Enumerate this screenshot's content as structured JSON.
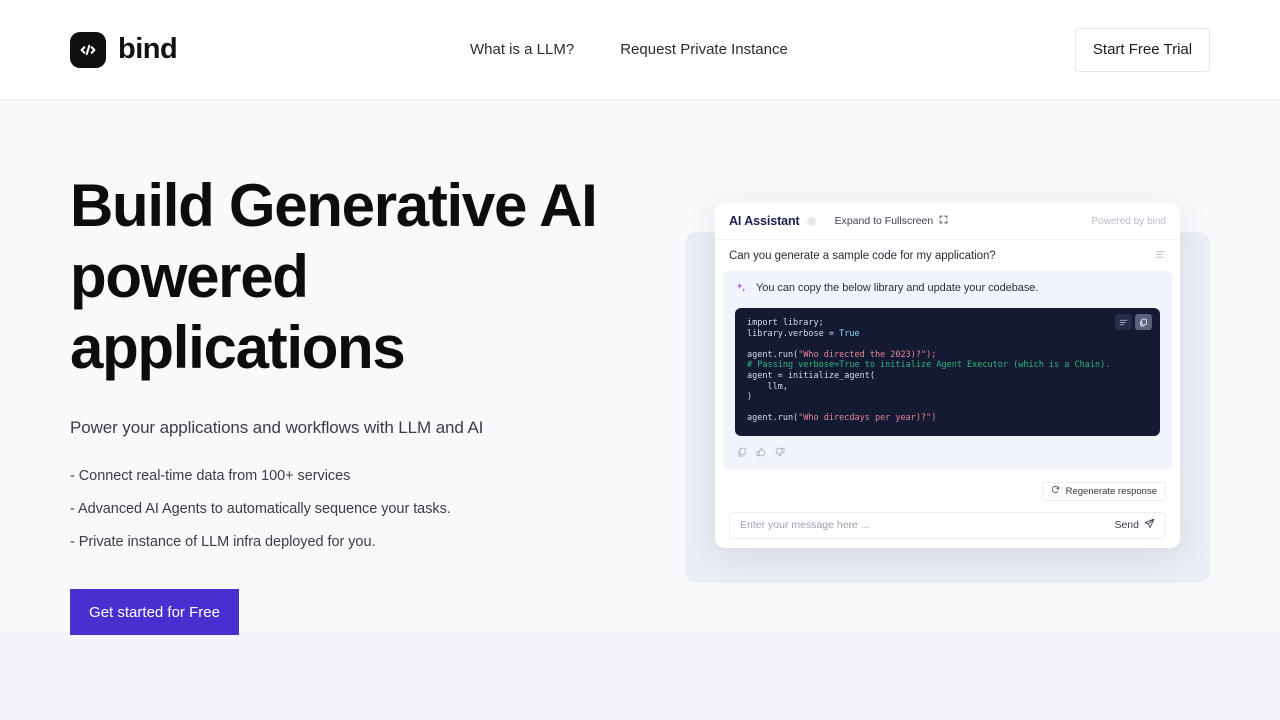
{
  "navbar": {
    "brand_name": "bind",
    "brand_icon": "code-brackets-icon",
    "links": [
      {
        "label": "What is a LLM?"
      },
      {
        "label": "Request Private Instance"
      }
    ],
    "trial_button": "Start Free Trial"
  },
  "hero": {
    "title": "Build Generative AI powered applications",
    "subtitle": "Power your applications and workflows with LLM and AI",
    "bullets": [
      "- Connect real-time data from 100+ services",
      "- Advanced AI Agents to automatically sequence your tasks.",
      "- Private instance of LLM infra deployed for you."
    ],
    "cta_label": "Get started for Free",
    "cta_color": "#4b2ed0"
  },
  "widget": {
    "title": "AI Assistant",
    "expand_label": "Expand to Fullscreen",
    "expand_icon": "expand-fullscreen-icon",
    "powered_by": "Powered by bind",
    "user_message": "Can you generate a sample code for my application?",
    "assistant_message": "You can copy the below library and update your codebase.",
    "assistant_icon": "sparkle-icon",
    "code": {
      "lines": [
        {
          "text": "import library;",
          "type": "plain"
        },
        {
          "text": "library.verbose = ",
          "type": "plain",
          "tail": "True",
          "tail_type": "bool"
        },
        {
          "text": "",
          "type": "plain"
        },
        {
          "text": "agent.run(",
          "type": "plain",
          "tail": "\"Who directed the 2023)?\");",
          "tail_type": "str"
        },
        {
          "text": "# Passing verbose=True to initialize Agent Executor (which is a Chain).",
          "type": "comment"
        },
        {
          "text": "agent = initialize_agent(",
          "type": "plain"
        },
        {
          "text": "    llm,",
          "type": "plain"
        },
        {
          "text": ")",
          "type": "plain"
        },
        {
          "text": "",
          "type": "plain"
        },
        {
          "text": "agent.run(",
          "type": "plain",
          "tail": "\"Who direcdays per year)?\")",
          "tail_type": "str"
        }
      ],
      "background": "#151a33",
      "tools": [
        {
          "icon": "wrap-lines-icon",
          "active": false
        },
        {
          "icon": "copy-icon",
          "active": true
        }
      ]
    },
    "feedback_icons": [
      "copy-icon",
      "thumbs-up-icon",
      "thumbs-down-icon"
    ],
    "regenerate_label": "Regenerate response",
    "regenerate_icon": "refresh-icon",
    "composer_placeholder": "Enter your message here ...",
    "composer_value": "",
    "send_label": "Send",
    "send_icon": "paper-plane-icon"
  }
}
